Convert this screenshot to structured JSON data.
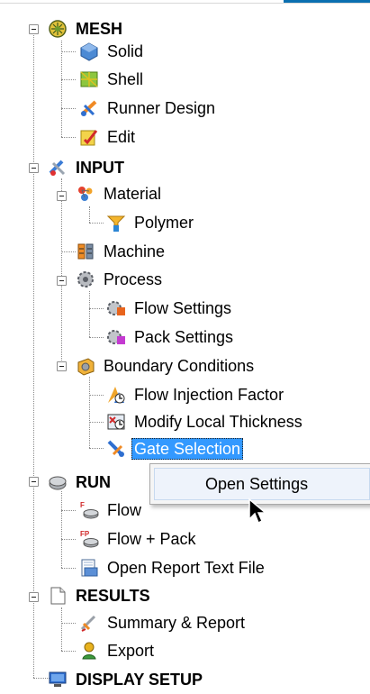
{
  "colors": {
    "selection": "#3399ff",
    "caption_bar": "#0a6fb0",
    "tree_lines": "#8a8a8a"
  },
  "tree": {
    "mesh": {
      "label": "MESH",
      "icon": "mesh-icon"
    },
    "solid": {
      "label": "Solid",
      "icon": "solid-icon"
    },
    "shell": {
      "label": "Shell",
      "icon": "shell-icon"
    },
    "runner": {
      "label": "Runner Design",
      "icon": "runner-design-icon"
    },
    "edit": {
      "label": "Edit",
      "icon": "edit-icon"
    },
    "input": {
      "label": "INPUT",
      "icon": "input-icon"
    },
    "material": {
      "label": "Material",
      "icon": "material-icon"
    },
    "polymer": {
      "label": "Polymer",
      "icon": "polymer-icon"
    },
    "machine": {
      "label": "Machine",
      "icon": "machine-icon"
    },
    "process": {
      "label": "Process",
      "icon": "process-icon"
    },
    "flow_settings": {
      "label": "Flow Settings",
      "icon": "flow-settings-icon"
    },
    "pack_settings": {
      "label": "Pack Settings",
      "icon": "pack-settings-icon"
    },
    "boundary": {
      "label": "Boundary Conditions",
      "icon": "boundary-conditions-icon"
    },
    "flow_injection": {
      "label": "Flow Injection Factor",
      "icon": "flow-injection-icon"
    },
    "modify_thickness": {
      "label": "Modify Local Thickness",
      "icon": "modify-thickness-icon"
    },
    "gate_selection": {
      "label": "Gate Selection",
      "icon": "gate-selection-icon"
    },
    "run": {
      "label": "RUN",
      "icon": "run-icon"
    },
    "flow": {
      "label": "Flow",
      "icon": "flow-icon"
    },
    "flow_pack": {
      "label": "Flow + Pack",
      "icon": "flow-pack-icon"
    },
    "open_report": {
      "label": "Open Report Text File",
      "icon": "report-file-icon"
    },
    "results": {
      "label": "RESULTS",
      "icon": "results-icon"
    },
    "summary": {
      "label": "Summary & Report",
      "icon": "summary-icon"
    },
    "export": {
      "label": "Export",
      "icon": "export-icon"
    },
    "display": {
      "label": "DISPLAY SETUP",
      "icon": "display-icon"
    }
  },
  "context_menu": {
    "items": [
      {
        "label": "Open Settings"
      }
    ]
  }
}
